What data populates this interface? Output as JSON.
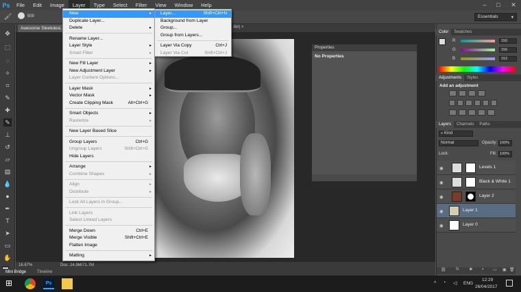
{
  "app": {
    "logo": "Ps"
  },
  "menubar": {
    "items": [
      "File",
      "Edit",
      "Image",
      "Layer",
      "Type",
      "Select",
      "Filter",
      "View",
      "Window",
      "Help"
    ],
    "active": "Layer",
    "window_controls": [
      "–",
      "□",
      "✕"
    ]
  },
  "options_bar": {
    "brush_size": "500",
    "workspace": "Essentials"
  },
  "document": {
    "tab_title": "Awesome Sleekdesi...",
    "tab_suffix": "/8#) ×",
    "zoom": "16.67%",
    "doc_info": "Doc: 24.9M/71.7M"
  },
  "bottom_tabs": [
    "Mini Bridge",
    "Timeline"
  ],
  "layer_menu": {
    "items": [
      {
        "label": "New",
        "shortcut": "",
        "submenu": true,
        "disabled": false,
        "highlighted": true
      },
      {
        "label": "Duplicate Layer...",
        "shortcut": "",
        "submenu": false,
        "disabled": false,
        "highlighted": false
      },
      {
        "label": "Delete",
        "shortcut": "",
        "submenu": true,
        "disabled": false,
        "highlighted": false
      },
      {
        "label": "Rename Layer...",
        "shortcut": "",
        "submenu": false,
        "disabled": false,
        "highlighted": false
      },
      {
        "label": "Layer Style",
        "shortcut": "",
        "submenu": true,
        "disabled": false,
        "highlighted": false
      },
      {
        "label": "Smart Filter",
        "shortcut": "",
        "submenu": true,
        "disabled": true,
        "highlighted": false
      },
      {
        "label": "New Fill Layer",
        "shortcut": "",
        "submenu": true,
        "disabled": false,
        "highlighted": false
      },
      {
        "label": "New Adjustment Layer",
        "shortcut": "",
        "submenu": true,
        "disabled": false,
        "highlighted": false
      },
      {
        "label": "Layer Content Options...",
        "shortcut": "",
        "submenu": false,
        "disabled": true,
        "highlighted": false
      },
      {
        "label": "Layer Mask",
        "shortcut": "",
        "submenu": true,
        "disabled": false,
        "highlighted": false
      },
      {
        "label": "Vector Mask",
        "shortcut": "",
        "submenu": true,
        "disabled": false,
        "highlighted": false
      },
      {
        "label": "Create Clipping Mask",
        "shortcut": "Alt+Ctrl+G",
        "submenu": false,
        "disabled": false,
        "highlighted": false
      },
      {
        "label": "Smart Objects",
        "shortcut": "",
        "submenu": true,
        "disabled": false,
        "highlighted": false
      },
      {
        "label": "Rasterize",
        "shortcut": "",
        "submenu": true,
        "disabled": true,
        "highlighted": false
      },
      {
        "label": "New Layer Based Slice",
        "shortcut": "",
        "submenu": false,
        "disabled": false,
        "highlighted": false
      },
      {
        "label": "Group Layers",
        "shortcut": "Ctrl+G",
        "submenu": false,
        "disabled": false,
        "highlighted": false
      },
      {
        "label": "Ungroup Layers",
        "shortcut": "Shift+Ctrl+G",
        "submenu": false,
        "disabled": true,
        "highlighted": false
      },
      {
        "label": "Hide Layers",
        "shortcut": "",
        "submenu": false,
        "disabled": false,
        "highlighted": false
      },
      {
        "label": "Arrange",
        "shortcut": "",
        "submenu": true,
        "disabled": false,
        "highlighted": false
      },
      {
        "label": "Combine Shapes",
        "shortcut": "",
        "submenu": true,
        "disabled": true,
        "highlighted": false
      },
      {
        "label": "Align",
        "shortcut": "",
        "submenu": true,
        "disabled": true,
        "highlighted": false
      },
      {
        "label": "Distribute",
        "shortcut": "",
        "submenu": true,
        "disabled": true,
        "highlighted": false
      },
      {
        "label": "Lock All Layers in Group...",
        "shortcut": "",
        "submenu": false,
        "disabled": true,
        "highlighted": false
      },
      {
        "label": "Link Layers",
        "shortcut": "",
        "submenu": false,
        "disabled": true,
        "highlighted": false
      },
      {
        "label": "Select Linked Layers",
        "shortcut": "",
        "submenu": false,
        "disabled": true,
        "highlighted": false
      },
      {
        "label": "Merge Down",
        "shortcut": "Ctrl+E",
        "submenu": false,
        "disabled": false,
        "highlighted": false
      },
      {
        "label": "Merge Visible",
        "shortcut": "Shift+Ctrl+E",
        "submenu": false,
        "disabled": false,
        "highlighted": false
      },
      {
        "label": "Flatten Image",
        "shortcut": "",
        "submenu": false,
        "disabled": false,
        "highlighted": false
      },
      {
        "label": "Matting",
        "shortcut": "",
        "submenu": true,
        "disabled": false,
        "highlighted": false
      }
    ]
  },
  "new_submenu": {
    "items": [
      {
        "label": "Layer...",
        "shortcut": "Shift+Ctrl+N",
        "disabled": false,
        "highlighted": true
      },
      {
        "label": "Background from Layer",
        "shortcut": "",
        "disabled": false,
        "highlighted": false
      },
      {
        "label": "Group...",
        "shortcut": "",
        "disabled": false,
        "highlighted": false
      },
      {
        "label": "Group from Layers...",
        "shortcut": "",
        "disabled": false,
        "highlighted": false
      },
      {
        "label": "Layer Via Copy",
        "shortcut": "Ctrl+J",
        "disabled": false,
        "highlighted": false
      },
      {
        "label": "Layer Via Cut",
        "shortcut": "Shift+Ctrl+J",
        "disabled": true,
        "highlighted": false
      }
    ]
  },
  "properties_panel": {
    "title": "Properties",
    "content": "No Properties"
  },
  "color_panel": {
    "tabs": [
      "Color",
      "Swatches"
    ],
    "channels": [
      {
        "label": "R",
        "value": "150"
      },
      {
        "label": "G",
        "value": "156"
      },
      {
        "label": "B",
        "value": "152"
      }
    ]
  },
  "adjustments_panel": {
    "tabs": [
      "Adjustments",
      "Styles"
    ],
    "heading": "Add an adjustment"
  },
  "layers_panel": {
    "tabs": [
      "Layers",
      "Channels",
      "Paths"
    ],
    "kind": "Kind",
    "blend_mode": "Normal",
    "opacity_label": "Opacity:",
    "opacity": "100%",
    "lock_label": "Lock:",
    "fill_label": "Fill:",
    "fill": "100%",
    "layers": [
      {
        "name": "Levels 1",
        "selected": false
      },
      {
        "name": "Black & White 1",
        "selected": false
      },
      {
        "name": "Layer 2",
        "selected": false
      },
      {
        "name": "Layer 1",
        "selected": true
      },
      {
        "name": "Layer 0",
        "selected": false
      }
    ]
  },
  "taskbar": {
    "time": "12:29",
    "date": "26/04/2017",
    "lang": "ENG"
  },
  "colors": {
    "highlight": "#3399ff",
    "ps_blue": "#31a8ff",
    "selected_layer": "#5a6c82"
  }
}
